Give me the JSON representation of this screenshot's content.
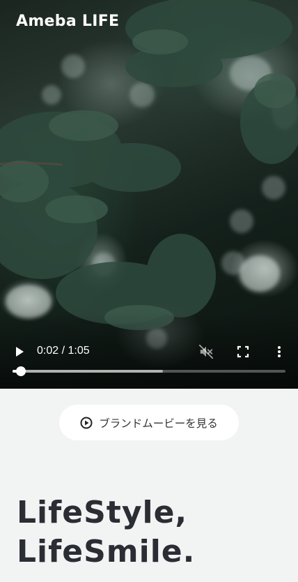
{
  "header": {
    "logo_text": "Ameba LIFE"
  },
  "video": {
    "current_time": "0:02",
    "time_separator": "/",
    "duration": "1:05",
    "progress_fraction": 0.031,
    "buffered_fraction": 0.55,
    "play_icon": "play-icon",
    "mute_icon": "volume-muted-icon",
    "fullscreen_icon": "fullscreen-icon",
    "more_icon": "more-vertical-icon"
  },
  "brand_movie_button": {
    "label": "ブランドムービーを見る",
    "icon": "play-circle-icon"
  },
  "hero": {
    "line1": "LifeStyle,",
    "line2": "LifeSmile."
  },
  "colors": {
    "page_background": "#f2f3f3",
    "headline": "#2a2d33",
    "button_background": "#ffffff"
  }
}
